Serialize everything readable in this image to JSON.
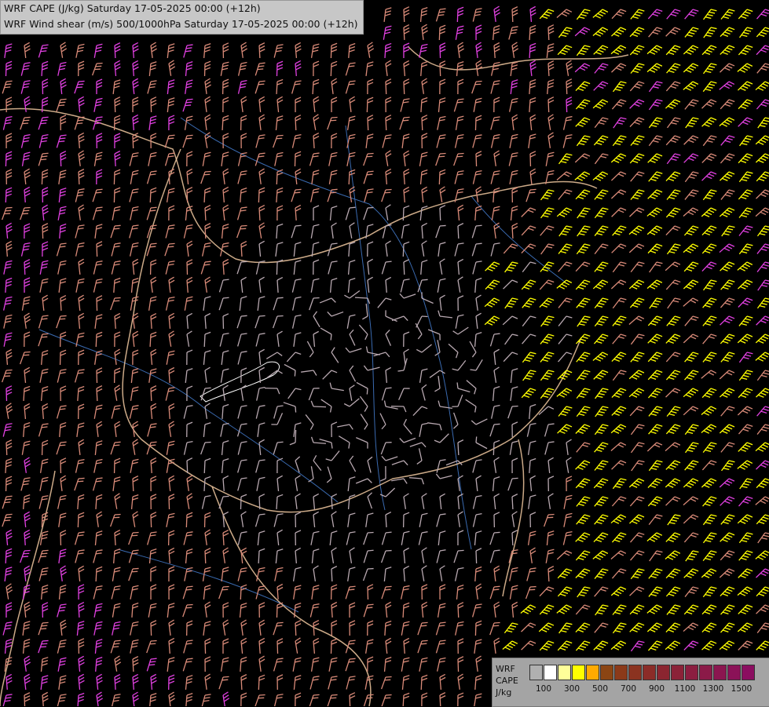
{
  "titles": {
    "line1": "WRF CAPE (J/kg) Saturday 17-05-2025 00:00 (+12h)",
    "line2": "WRF Wind shear (m/s) 500/1000hPa Saturday 17-05-2025 00:00 (+12h)"
  },
  "legend": {
    "label_wrf": "WRF",
    "label_cape": "CAPE",
    "label_unit": "J/kg",
    "swatch_colors": [
      "#b0b0b0",
      "#ffffff",
      "#ffff99",
      "#ffff00",
      "#ffaa00",
      "#8b4513",
      "#8b3a1a",
      "#8b3320",
      "#8b2c28",
      "#8b2530",
      "#8b2238",
      "#8b1e40",
      "#8b1a48",
      "#8b1650",
      "#8b1258",
      "#8b0e60"
    ],
    "tick_labels": [
      "100",
      "300",
      "500",
      "700",
      "900",
      "1100",
      "1300",
      "1500"
    ]
  },
  "colors": {
    "barb_low": "#b8a8b0",
    "barb_mid": "#d88a78",
    "barb_high": "#e040e0",
    "barb_strong_cape": "#ffff00",
    "border": "#f0c8a0",
    "river": "#3a6ab0"
  },
  "icons": {
    "wind_barb": "wind-barb-icon"
  }
}
